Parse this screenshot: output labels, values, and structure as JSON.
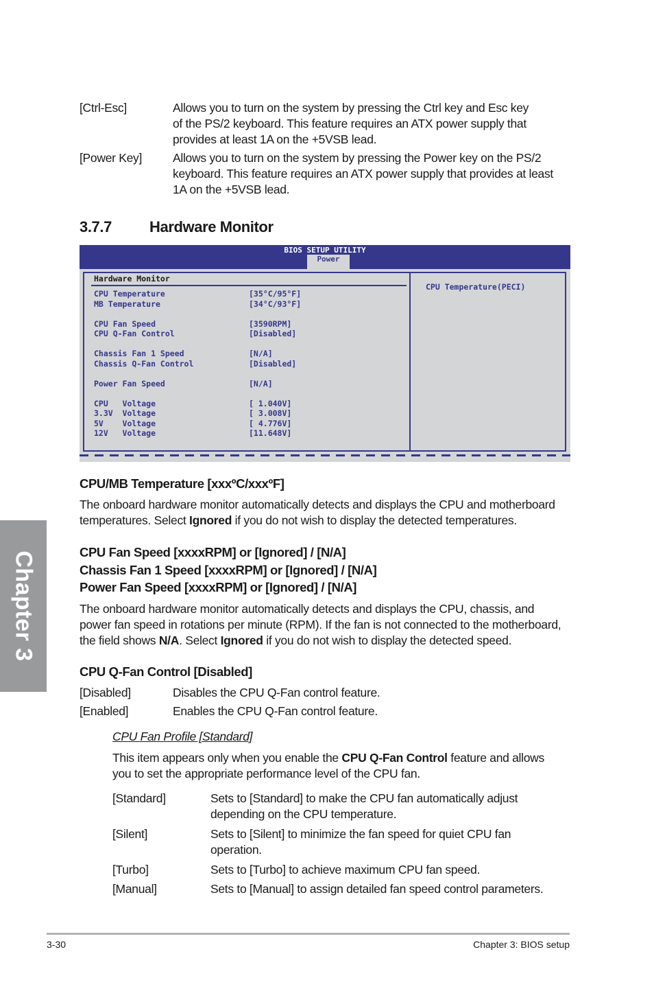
{
  "intro_options": [
    {
      "key": "[Ctrl-Esc]",
      "lines": [
        "Allows you to turn on the system by pressing the Ctrl key and Esc key",
        "of the PS/2 keyboard. This feature requires an ATX power supply that",
        "provides at least 1A on the +5VSB lead."
      ]
    },
    {
      "key": "[Power Key]",
      "lines": [
        "Allows you to turn on the system by pressing the Power key on the PS/2",
        "keyboard. This feature requires an ATX power supply that provides at least",
        "1A on the +5VSB lead."
      ]
    }
  ],
  "section": {
    "number": "3.7.7",
    "title": "Hardware Monitor"
  },
  "bios": {
    "title": "BIOS SETUP UTILITY",
    "active_tab": "Power",
    "panel_title": "Hardware Monitor",
    "help_text": "CPU Temperature(PECI)",
    "rows": [
      {
        "label": "CPU Temperature",
        "value": "[35°C/95°F]"
      },
      {
        "label": "MB Temperature",
        "value": "[34°C/93°F]"
      },
      {
        "label": "CPU Fan Speed",
        "value": "[3590RPM]"
      },
      {
        "label": "CPU Q-Fan Control",
        "value": "[Disabled]"
      },
      {
        "label": "Chassis Fan 1 Speed",
        "value": "[N/A]"
      },
      {
        "label": "Chassis Q-Fan Control",
        "value": "[Disabled]"
      },
      {
        "label": "Power Fan Speed",
        "value": "[N/A]"
      },
      {
        "label": "CPU   Voltage",
        "value": "[ 1.040V]"
      },
      {
        "label": "3.3V  Voltage",
        "value": "[ 3.008V]"
      },
      {
        "label": "5V    Voltage",
        "value": "[ 4.776V]"
      },
      {
        "label": "12V   Voltage",
        "value": "[11.648V]"
      }
    ]
  },
  "temp_section": {
    "heading": "CPU/MB Temperature [xxxºC/xxxºF]",
    "line1": "The onboard hardware monitor automatically detects and displays the CPU and motherboard",
    "line2_pre": "temperatures. Select ",
    "line2_bold": "Ignored",
    "line2_post": " if you do not wish to display the detected temperatures."
  },
  "fan_section": {
    "headings": [
      "CPU Fan Speed [xxxxRPM] or [Ignored] / [N/A]",
      "Chassis Fan 1 Speed [xxxxRPM] or [Ignored] / [N/A]",
      "Power Fan Speed [xxxxRPM] or [Ignored] / [N/A]"
    ],
    "line1": "The onboard hardware monitor automatically detects and displays the CPU, chassis, and",
    "line2": "power fan speed in rotations per minute (RPM). If the fan is not connected to the motherboard,",
    "line3_pre": "the field shows ",
    "line3_bold1": "N/A",
    "line3_mid": ". Select ",
    "line3_bold2": "Ignored",
    "line3_post": " if you do not wish to display the detected speed."
  },
  "qfan_section": {
    "heading": "CPU Q-Fan Control [Disabled]",
    "options": [
      {
        "key": "[Disabled]",
        "desc": "Disables the CPU Q-Fan control feature."
      },
      {
        "key": "[Enabled]",
        "desc": "Enables the CPU Q-Fan control feature."
      }
    ]
  },
  "profile_section": {
    "heading": "CPU Fan Profile [Standard]",
    "line1_pre": "This item appears only when you enable the ",
    "line1_bold": "CPU Q-Fan Control",
    "line1_post": " feature and allows",
    "line2": "you to set the appropriate performance level of the CPU fan.",
    "options": [
      {
        "key": "[Standard]",
        "lines": [
          "Sets to [Standard] to make the CPU fan automatically adjust",
          "depending on the CPU temperature."
        ]
      },
      {
        "key": "[Silent]",
        "lines": [
          "Sets to [Silent] to minimize the fan speed for quiet CPU fan",
          "operation."
        ]
      },
      {
        "key": "[Turbo]",
        "lines": [
          "Sets to [Turbo] to achieve maximum CPU fan speed."
        ]
      },
      {
        "key": "[Manual]",
        "lines": [
          "Sets to [Manual] to assign detailed fan speed control parameters."
        ]
      }
    ]
  },
  "chapter_tab": "Chapter 3",
  "footer": {
    "page": "3-30",
    "chapter": "Chapter 3: BIOS setup"
  }
}
